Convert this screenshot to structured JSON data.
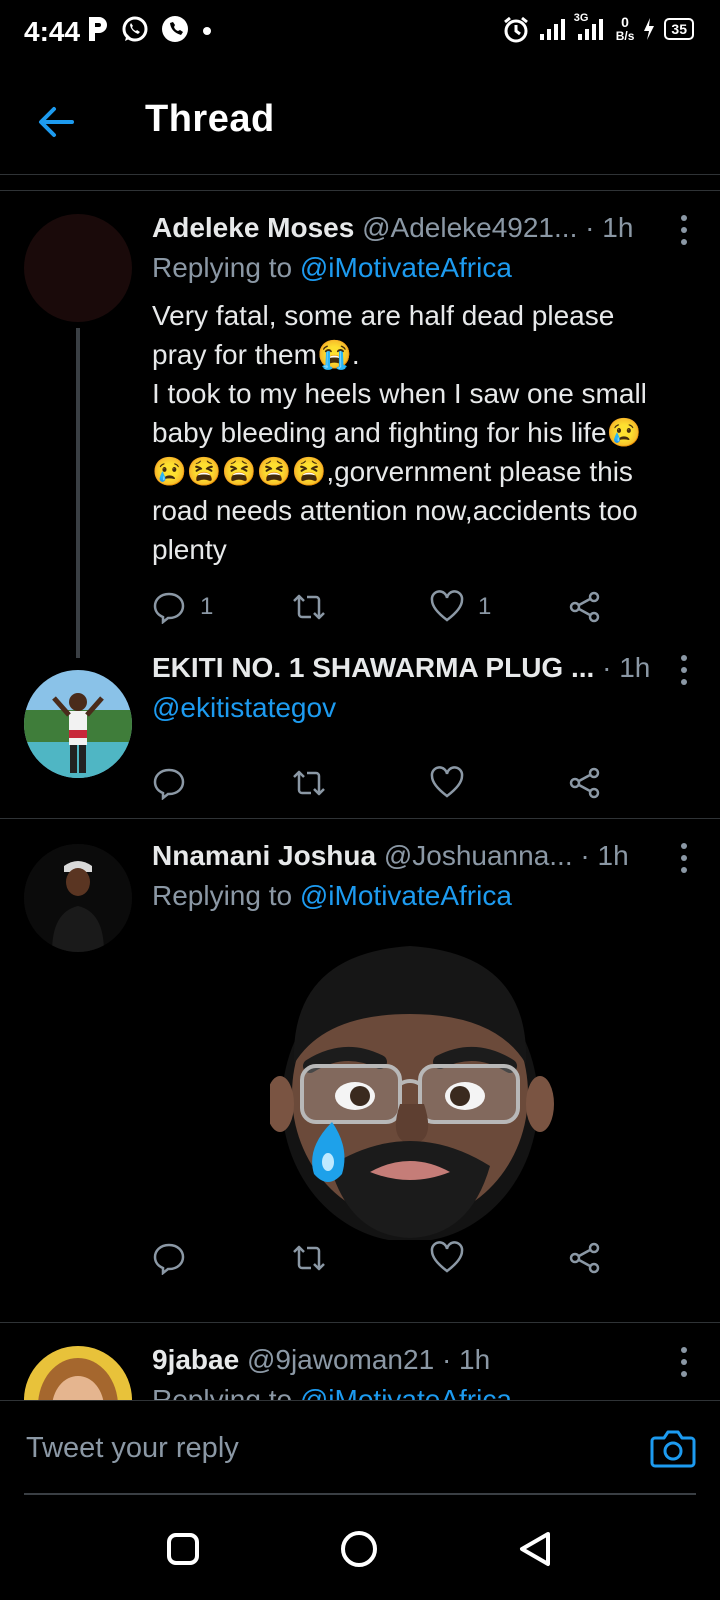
{
  "status_bar": {
    "time": "4:44",
    "network_label": "3G",
    "data_speed_value": "0",
    "data_speed_unit": "B/s",
    "battery": "35"
  },
  "header": {
    "title": "Thread",
    "back_icon": "arrow-left-icon"
  },
  "tweets": [
    {
      "name": "Adeleke Moses",
      "handle": "@Adeleke4921...",
      "time": "· 1h",
      "replying_prefix": "Replying to",
      "replying_to": "@iMotivateAfrica",
      "text_lines": [
        "Very fatal, some are half dead please",
        "pray for them😭.",
        "I took to my heels when I saw one small",
        "baby bleeding and fighting for his life😢",
        "😢😫😫😫😫,gorvernment please this",
        "road needs attention now,accidents too",
        "plenty"
      ],
      "reply_count": "1",
      "retweet_count": "",
      "like_count": "1"
    },
    {
      "name": "EKITI NO. 1 SHAWARMA PLUG ...",
      "time": "· 1h",
      "text": "@ekitistategov"
    },
    {
      "name": "Nnamani Joshua",
      "handle": "@Joshuanna...",
      "time": "· 1h",
      "replying_prefix": "Replying to",
      "replying_to": "@iMotivateAfrica"
    },
    {
      "name": "9jabae",
      "handle": "@9jawoman21",
      "time": "· 1h",
      "replying_prefix": "Replying to",
      "replying_to": "@iMotivateAfrica"
    }
  ],
  "composer": {
    "placeholder": "Tweet your reply",
    "camera_icon": "camera-icon"
  },
  "nav_bar": {
    "icons": [
      "recents-square-icon",
      "home-circle-icon",
      "back-triangle-icon"
    ]
  },
  "colors": {
    "background": "#000000",
    "accent": "#1d9bf0",
    "secondary_text": "#8b98a5",
    "divider": "#2f3336"
  }
}
